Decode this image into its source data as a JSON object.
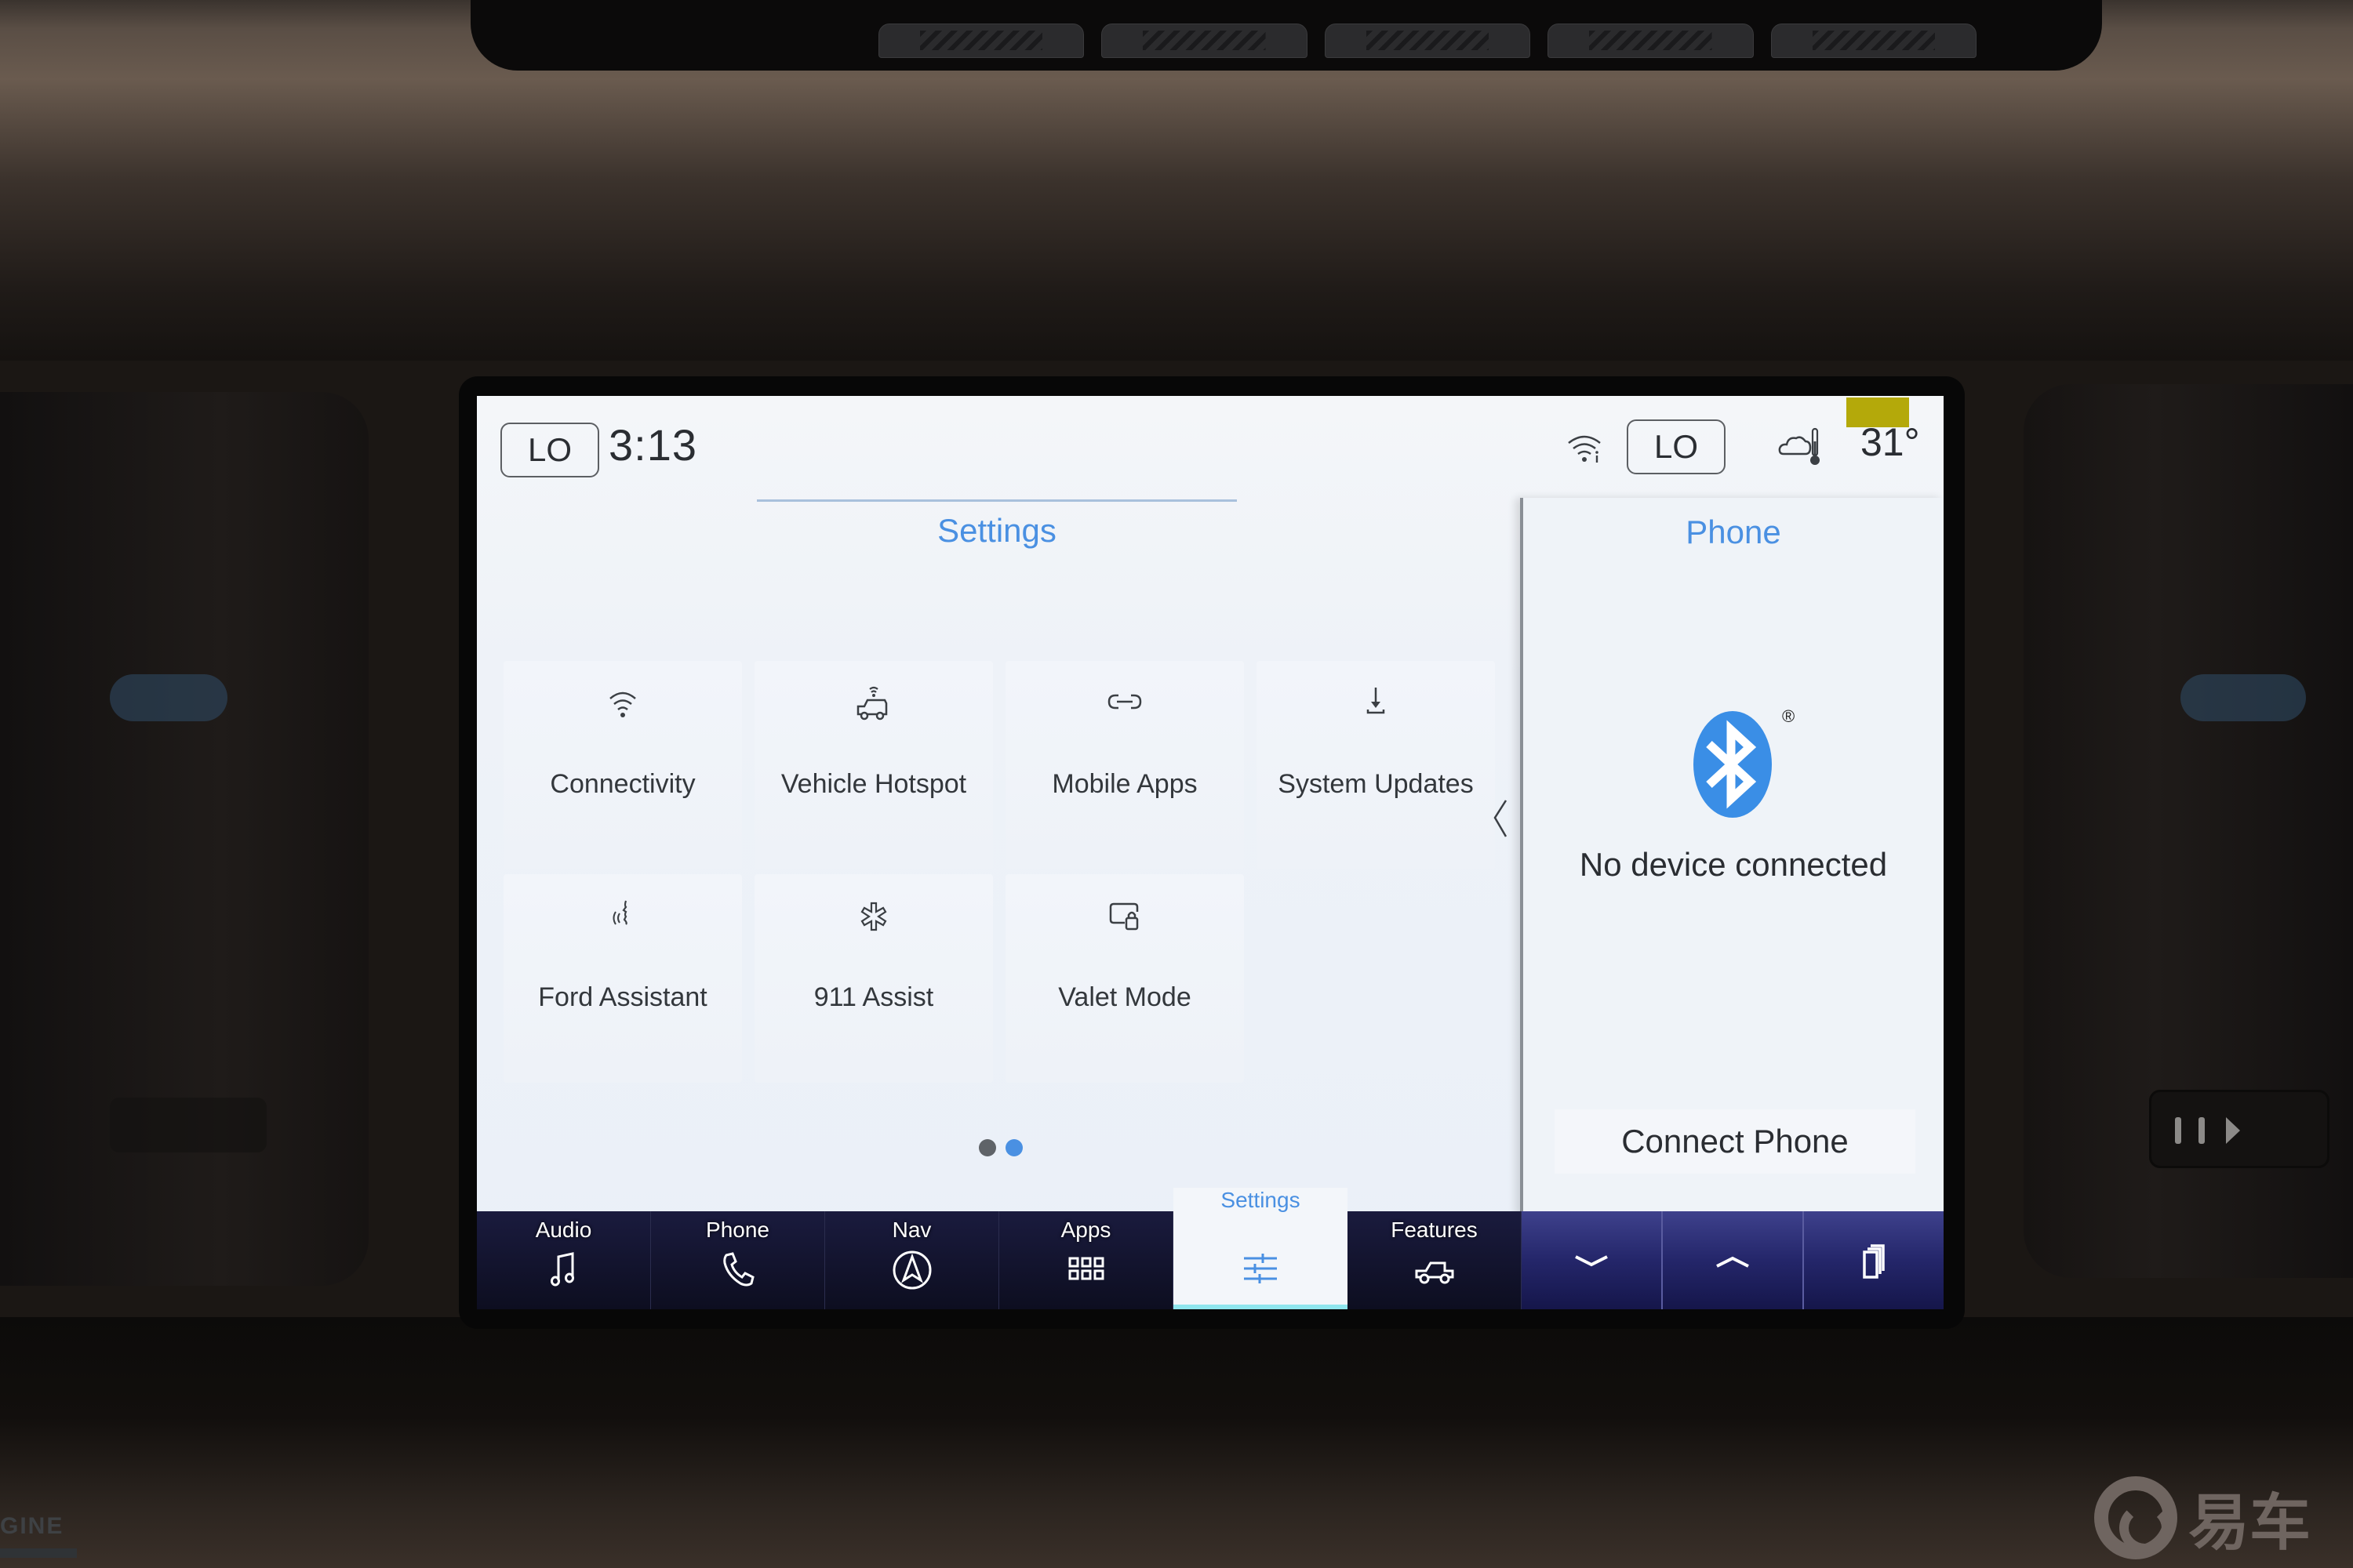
{
  "surroundings": {
    "engine_label": "GINE",
    "watermark_text": "易车"
  },
  "status_bar": {
    "driver_temp": "LO",
    "clock": "3:13",
    "passenger_temp": "LO",
    "outside_temp": "31°",
    "wifi_icon": "wifi-info-icon",
    "weather_icon": "cloud-thermometer-icon",
    "badge_color": "#b4a90a"
  },
  "settings": {
    "title": "Settings",
    "tiles": [
      {
        "label": "Connectivity",
        "icon": "wifi-icon"
      },
      {
        "label": "Vehicle Hotspot",
        "icon": "vehicle-hotspot-icon"
      },
      {
        "label": "Mobile Apps",
        "icon": "link-icon"
      },
      {
        "label": "System Updates",
        "icon": "download-icon"
      },
      {
        "label": "Ford Assistant",
        "icon": "voice-assistant-icon"
      },
      {
        "label": "911 Assist",
        "icon": "star-of-life-icon"
      },
      {
        "label": "Valet Mode",
        "icon": "screen-lock-icon"
      }
    ],
    "page_count": 2,
    "active_page": 2,
    "accent_color": "#4a90e2",
    "inactive_dot_color": "#5f6368"
  },
  "phone_panel": {
    "title": "Phone",
    "bluetooth_color": "#3a8ee6",
    "status_text": "No device connected",
    "registered_mark": "®",
    "connect_button": "Connect Phone"
  },
  "nav": {
    "items": [
      {
        "label": "Audio",
        "icon": "music-note-icon"
      },
      {
        "label": "Phone",
        "icon": "phone-icon"
      },
      {
        "label": "Nav",
        "icon": "navigation-icon"
      },
      {
        "label": "Apps",
        "icon": "apps-grid-icon"
      },
      {
        "label": "Settings",
        "icon": "sliders-icon",
        "active": true
      },
      {
        "label": "Features",
        "icon": "truck-icon"
      }
    ],
    "controls": [
      {
        "icon": "chevron-down-icon"
      },
      {
        "icon": "chevron-up-icon"
      },
      {
        "icon": "cards-icon"
      }
    ]
  }
}
